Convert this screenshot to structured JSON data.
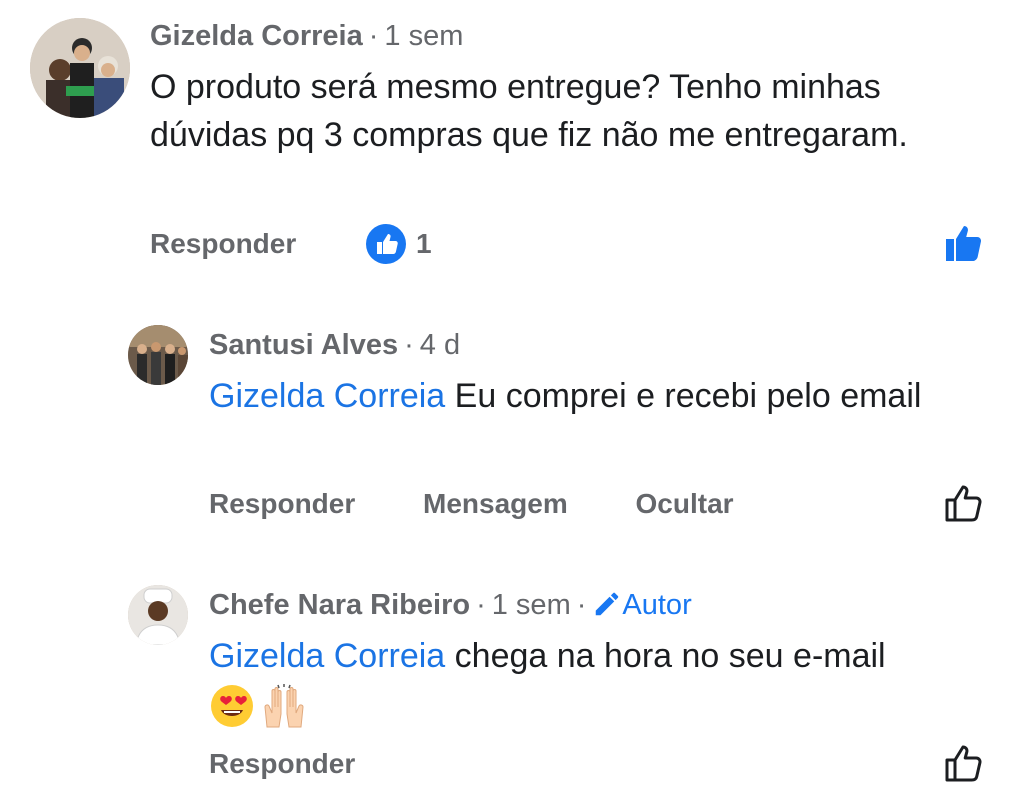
{
  "comments": [
    {
      "author": "Gizelda Correia",
      "time": "1 sem",
      "text": "O produto será mesmo entregue? Tenho minhas dúvidas pq 3 compras que fiz não me entregaram.",
      "reply_label": "Responder",
      "reaction_count": "1",
      "liked": true
    },
    {
      "author": "Santusi Alves",
      "time": "4 d",
      "mention": "Gizelda Correia",
      "text": " Eu comprei e recebi pelo email",
      "reply_label": "Responder",
      "message_label": "Mensagem",
      "hide_label": "Ocultar"
    },
    {
      "author": "Chefe Nara Ribeiro",
      "time": "1 sem",
      "badge": "Autor",
      "mention": "Gizelda Correia",
      "text": " chega na hora no seu e-mail",
      "emojis": [
        "heart-eyes-emoji",
        "raised-hands-emoji"
      ],
      "reply_label": "Responder"
    }
  ],
  "colors": {
    "accent": "#1877f2",
    "mention": "#1b74e4",
    "meta": "#65676b",
    "text": "#1c1e21"
  }
}
